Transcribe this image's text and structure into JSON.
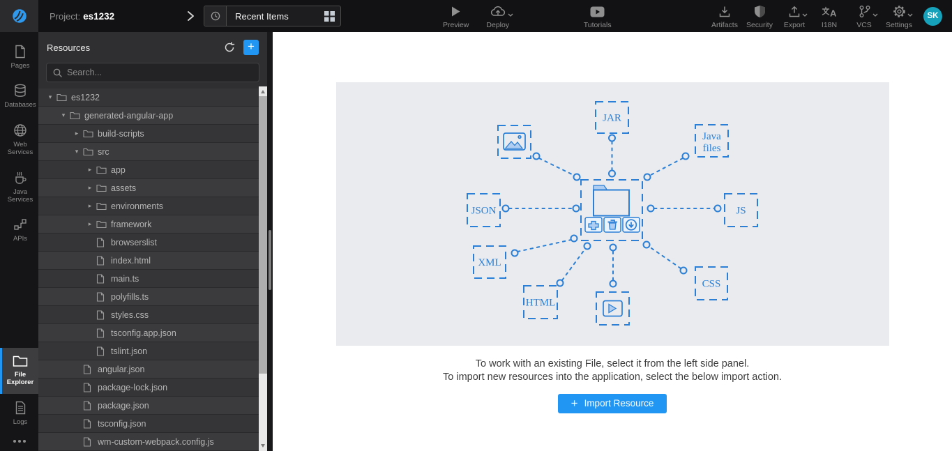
{
  "topbar": {
    "project_label": "Project:",
    "project_name": "es1232",
    "recent_items": "Recent Items",
    "preview": "Preview",
    "deploy": "Deploy",
    "tutorials": "Tutorials",
    "artifacts": "Artifacts",
    "security": "Security",
    "export": "Export",
    "i18n": "I18N",
    "vcs": "VCS",
    "settings": "Settings",
    "avatar_initials": "SK"
  },
  "sidebar": {
    "items": [
      {
        "label": "Pages"
      },
      {
        "label": "Databases"
      },
      {
        "label": "Web Services"
      },
      {
        "label": "Java Services"
      },
      {
        "label": "APIs"
      },
      {
        "label": "File Explorer",
        "active": true
      },
      {
        "label": "Logs"
      }
    ]
  },
  "file_explorer": {
    "title": "Resources",
    "search_placeholder": "Search...",
    "caret_expanded": "▾",
    "caret_collapsed": "▸",
    "tree": [
      {
        "label": "es1232",
        "level": 0,
        "type": "folder",
        "state": "expanded"
      },
      {
        "label": "generated-angular-app",
        "level": 1,
        "type": "folder",
        "state": "expanded"
      },
      {
        "label": "build-scripts",
        "level": 2,
        "type": "folder",
        "state": "collapsed"
      },
      {
        "label": "src",
        "level": 2,
        "type": "folder",
        "state": "expanded"
      },
      {
        "label": "app",
        "level": 3,
        "type": "folder",
        "state": "collapsed"
      },
      {
        "label": "assets",
        "level": 3,
        "type": "folder",
        "state": "collapsed"
      },
      {
        "label": "environments",
        "level": 3,
        "type": "folder",
        "state": "collapsed"
      },
      {
        "label": "framework",
        "level": 3,
        "type": "folder",
        "state": "collapsed"
      },
      {
        "label": "browserslist",
        "level": 3,
        "type": "file"
      },
      {
        "label": "index.html",
        "level": 3,
        "type": "file"
      },
      {
        "label": "main.ts",
        "level": 3,
        "type": "file"
      },
      {
        "label": "polyfills.ts",
        "level": 3,
        "type": "file"
      },
      {
        "label": "styles.css",
        "level": 3,
        "type": "file"
      },
      {
        "label": "tsconfig.app.json",
        "level": 3,
        "type": "file"
      },
      {
        "label": "tslint.json",
        "level": 3,
        "type": "file"
      },
      {
        "label": "angular.json",
        "level": 2,
        "type": "file"
      },
      {
        "label": "package-lock.json",
        "level": 2,
        "type": "file"
      },
      {
        "label": "package.json",
        "level": 2,
        "type": "file"
      },
      {
        "label": "tsconfig.json",
        "level": 2,
        "type": "file"
      },
      {
        "label": "wm-custom-webpack.config.js",
        "level": 2,
        "type": "file"
      }
    ]
  },
  "main": {
    "diagram": {
      "nodes": {
        "jar": "JAR",
        "java_line1": "Java",
        "java_line2": "files",
        "json": "JSON",
        "js": "JS",
        "xml": "XML",
        "css": "CSS",
        "html": "HTML"
      }
    },
    "instruction_line1": "To work with an existing File, select it from the left side panel.",
    "instruction_line2": "To import new resources into the application, select the below import action.",
    "import_button": {
      "plus": "+",
      "label": "Import Resource"
    }
  },
  "colors": {
    "accent": "#2196f3",
    "diagram_blue": "#2b7fd6",
    "avatar_teal": "#16a2ba"
  }
}
